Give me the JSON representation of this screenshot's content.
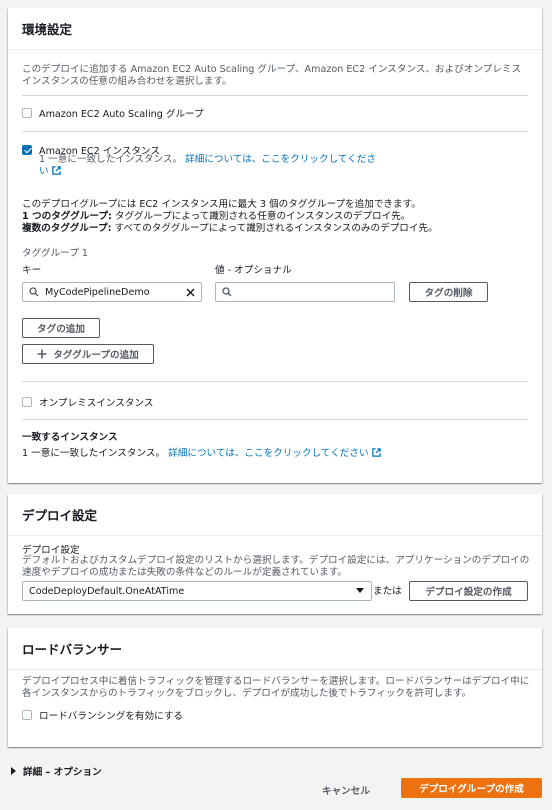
{
  "env": {
    "title": "環境設定",
    "description": "このデプロイに追加する Amazon EC2 Auto Scaling グループ、Amazon EC2 インスタンス、およびオンプレミスインスタンスの任意の組み合わせを選択します。",
    "asg_label": "Amazon EC2 Auto Scaling グループ",
    "ec2_label": "Amazon EC2 インスタンス",
    "ec2_match_prefix": "1 一意に一致したインスタンス。",
    "ec2_match_link": "詳細については、ここをクリックしてください",
    "tag_info_line1": "このデプロイグループには EC2 インスタンス用に最大 3 個のタググループを追加できます。",
    "tag_info_line2_bold": "1 つのタググループ:",
    "tag_info_line2": " タググループによって識別される任意のインスタンスのデプロイ先。",
    "tag_info_line3_bold": "複数のタググループ:",
    "tag_info_line3": " すべてのタググループによって識別されるインスタンスのみのデプロイ先。",
    "tag_group_label": "タググループ 1",
    "key_label": "キー",
    "value_label": "値 - オプショナル",
    "key_value": "MyCodePipelineDemo",
    "value_value": "",
    "remove_tag_btn": "タグの削除",
    "add_tag_btn": "タグの追加",
    "add_tag_group_btn": "タググループの追加",
    "onprem_label": "オンプレミスインスタンス",
    "matching_title": "一致するインスタンス",
    "matching_prefix": "1 一意に一致したインスタンス。",
    "matching_link": "詳細については、ここをクリックしてください"
  },
  "deploy": {
    "title": "デプロイ設定",
    "config_label": "デプロイ設定",
    "config_desc": "デフォルトおよびカスタムデプロイ設定のリストから選択します。デプロイ設定には、アプリケーションのデプロイの速度やデプロイの成功または失敗の条件などのルールが定義されています。",
    "selected": "CodeDeployDefault.OneAtATime",
    "or_text": "または",
    "create_btn": "デプロイ設定の作成"
  },
  "lb": {
    "title": "ロードバランサー",
    "desc": "デプロイプロセス中に着信トラフィックを管理するロードバランサーを選択します。ロードバランサーはデプロイ中に各インスタンスからのトラフィックをブロックし、デプロイが成功した後でトラフィックを許可します。",
    "enable_label": "ロードバランシングを有効にする"
  },
  "advanced": {
    "label": "詳細 – オプション"
  },
  "footer": {
    "cancel": "キャンセル",
    "create": "デプロイグループの作成"
  },
  "colors": {
    "primary": "#ec7211",
    "link": "#0073bb",
    "checkbox": "#0073bb"
  }
}
